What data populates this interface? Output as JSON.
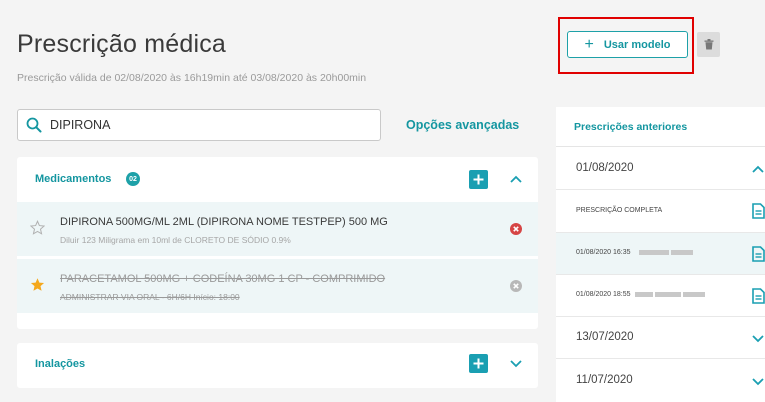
{
  "page": {
    "title": "Prescrição médica",
    "validity": "Prescrição válida de 02/08/2020 às 16h19min até 03/08/2020 às 20h00min"
  },
  "toolbar": {
    "use_model_label": "Usar modelo",
    "use_model_icon": "plus-icon",
    "trash_icon": "trash-icon"
  },
  "search": {
    "value": "DIPIRONA",
    "placeholder": "",
    "advanced_label": "Opções avançadas"
  },
  "medicamentos": {
    "label": "Medicamentos",
    "count": "02",
    "items": [
      {
        "name": "DIPIRONA 500MG/ML 2ML (DIPIRONA NOME TESTPEP) 500 MG",
        "dose": "Diluir 123 Miligrama em 10ml de CLORETO DE SÓDIO 0.9%",
        "favorite": false,
        "suspended": false
      },
      {
        "name": "PARACETAMOL 500MG + CODEÍNA 30MG 1 CP - COMPRIMIDO",
        "dose": "ADMINISTRAR VIA ORAL - 6H/6H Início: 18:00",
        "favorite": true,
        "suspended": true
      }
    ]
  },
  "inalacoes": {
    "label": "Inalações"
  },
  "previous": {
    "title": "Prescrições anteriores",
    "groups": [
      {
        "date": "01/08/2020",
        "expanded": true,
        "entries": [
          {
            "label": "PRESCRIÇÃO COMPLETA"
          },
          {
            "label": "01/08/2020 16:35"
          },
          {
            "label": "01/08/2020 18:55"
          }
        ]
      },
      {
        "date": "13/07/2020",
        "expanded": false
      },
      {
        "date": "11/07/2020",
        "expanded": false
      }
    ]
  },
  "colors": {
    "accent": "#1496a0",
    "highlight": "#e00000",
    "row_bg": "#eef6f7",
    "error": "#d64545"
  }
}
